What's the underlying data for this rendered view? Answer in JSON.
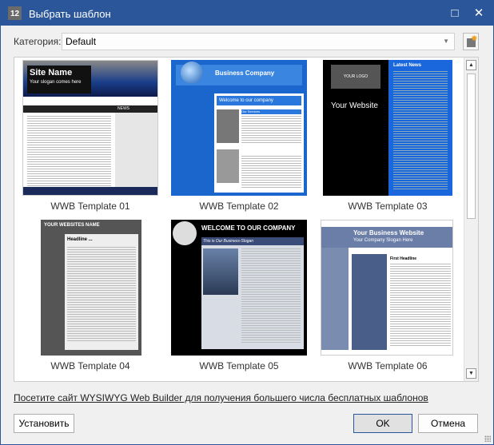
{
  "window": {
    "title": "Выбрать шаблон",
    "app_icon_text": "12",
    "maximize_icon": "□",
    "close_icon": "✕"
  },
  "category": {
    "label": "Категория:",
    "value": "Default"
  },
  "templates": [
    {
      "name": "WWB Template 01",
      "heading": "Site Name",
      "sub": "Your slogan comes here",
      "extra": "NEWS"
    },
    {
      "name": "WWB Template 02",
      "heading": "Business Company",
      "sub": "Welcome to our company",
      "extra": "Our Services"
    },
    {
      "name": "WWB Template 03",
      "heading": "Your Website",
      "sub": "YOUR LOGO",
      "extra": "Latest News"
    },
    {
      "name": "WWB Template 04",
      "heading": "YOUR WEBSITES NAME",
      "sub": "Headline ...",
      "extra": ""
    },
    {
      "name": "WWB Template 05",
      "heading": "WELCOME TO OUR COMPANY",
      "sub": "This is Our Business-Slogan",
      "extra": ""
    },
    {
      "name": "WWB Template 06",
      "heading": "Your Business Website",
      "sub": "Your Company Slogan Here",
      "extra": "First Headline"
    }
  ],
  "link": "Посетите сайт WYSIWYG Web Builder для получения большего числа бесплатных шаблонов",
  "buttons": {
    "install": "Установить",
    "ok": "OK",
    "cancel": "Отмена"
  }
}
